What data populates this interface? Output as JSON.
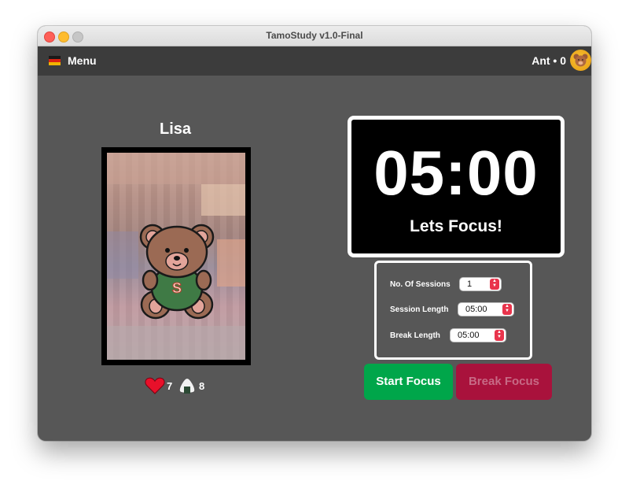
{
  "window": {
    "title": "TamoStudy v1.0-Final"
  },
  "toolbar": {
    "menu_label": "Menu",
    "user_label": "Ant • 0",
    "flag_colors": [
      "#1a1a1a",
      "#dd2211",
      "#f0b400"
    ],
    "avatar_icon": "bear-coin-icon"
  },
  "pet": {
    "name": "Lisa",
    "shirt_letter": "S",
    "stats": {
      "happiness_icon": "heart-icon",
      "happiness": "7",
      "hunger_icon": "onigiri-icon",
      "hunger": "8"
    }
  },
  "timer": {
    "display": "05:00",
    "status": "Lets Focus!"
  },
  "settings": {
    "sessions_label": "No. Of Sessions",
    "sessions_value": "1",
    "session_length_label": "Session Length",
    "session_length_value": "05:00",
    "break_length_label": "Break Length",
    "break_length_value": "05:00"
  },
  "buttons": {
    "start_label": "Start Focus",
    "break_label": "Break Focus"
  },
  "colors": {
    "background": "#575757",
    "toolbar": "#3c3c3c",
    "start_button": "#00a64a",
    "break_button": "#a9123c",
    "stepper_accent": "#e9344c"
  }
}
